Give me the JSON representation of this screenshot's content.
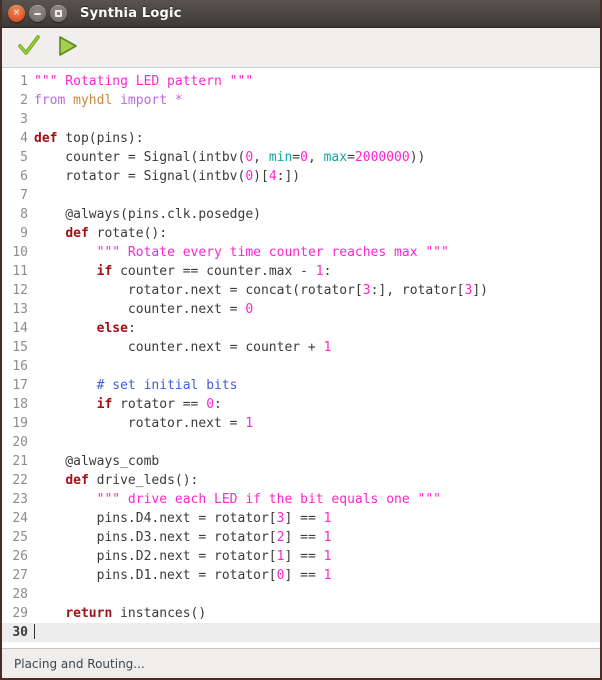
{
  "window": {
    "title": "Synthia Logic",
    "controls": [
      {
        "name": "close",
        "glyph": "×"
      },
      {
        "name": "minimize",
        "glyph": "–"
      },
      {
        "name": "maximize",
        "glyph": "□"
      }
    ]
  },
  "toolbar": {
    "buttons": [
      {
        "name": "check-icon",
        "label": "Check",
        "color": "#7cb518"
      },
      {
        "name": "play-icon",
        "label": "Run",
        "color": "#8cc63f"
      }
    ]
  },
  "statusbar": {
    "message": "Placing and Routing..."
  },
  "editor": {
    "current_line": 30,
    "total_lines": 30,
    "colors": {
      "keyword": "#a11117",
      "string": "#ff25d0",
      "number": "#ff25d0",
      "kwarg": "#10a5a5",
      "comment": "#3f5ed8",
      "import": "#b96ad9",
      "module": "#c48a3f",
      "plain": "#3b3b3b",
      "current_line_bg": "#ededed"
    },
    "lines": [
      {
        "n": 1,
        "tokens": [
          {
            "t": "str",
            "s": "\"\"\" Rotating LED pattern \"\"\""
          }
        ]
      },
      {
        "n": 2,
        "tokens": [
          {
            "t": "imp",
            "s": "from "
          },
          {
            "t": "mod",
            "s": "myhdl"
          },
          {
            "t": "imp",
            "s": " import "
          },
          {
            "t": "imp",
            "s": "*"
          }
        ]
      },
      {
        "n": 3,
        "tokens": []
      },
      {
        "n": 4,
        "tokens": [
          {
            "t": "kw",
            "s": "def"
          },
          {
            "t": "pl",
            "s": " top(pins):"
          }
        ]
      },
      {
        "n": 5,
        "tokens": [
          {
            "t": "pl",
            "s": "    counter = Signal(intbv("
          },
          {
            "t": "num",
            "s": "0"
          },
          {
            "t": "pl",
            "s": ", "
          },
          {
            "t": "kwarg",
            "s": "min"
          },
          {
            "t": "pl",
            "s": "="
          },
          {
            "t": "num",
            "s": "0"
          },
          {
            "t": "pl",
            "s": ", "
          },
          {
            "t": "kwarg",
            "s": "max"
          },
          {
            "t": "pl",
            "s": "="
          },
          {
            "t": "num",
            "s": "2000000"
          },
          {
            "t": "pl",
            "s": "))"
          }
        ]
      },
      {
        "n": 6,
        "tokens": [
          {
            "t": "pl",
            "s": "    rotator = Signal(intbv("
          },
          {
            "t": "num",
            "s": "0"
          },
          {
            "t": "pl",
            "s": ")["
          },
          {
            "t": "num",
            "s": "4"
          },
          {
            "t": "pl",
            "s": ":])"
          }
        ]
      },
      {
        "n": 7,
        "tokens": []
      },
      {
        "n": 8,
        "tokens": [
          {
            "t": "pl",
            "s": "    @always(pins.clk.posedge)"
          }
        ]
      },
      {
        "n": 9,
        "tokens": [
          {
            "t": "pl",
            "s": "    "
          },
          {
            "t": "kw",
            "s": "def"
          },
          {
            "t": "pl",
            "s": " rotate():"
          }
        ]
      },
      {
        "n": 10,
        "tokens": [
          {
            "t": "pl",
            "s": "        "
          },
          {
            "t": "str",
            "s": "\"\"\" Rotate every time counter reaches max \"\"\""
          }
        ]
      },
      {
        "n": 11,
        "tokens": [
          {
            "t": "pl",
            "s": "        "
          },
          {
            "t": "kw",
            "s": "if"
          },
          {
            "t": "pl",
            "s": " counter == counter.max - "
          },
          {
            "t": "num",
            "s": "1"
          },
          {
            "t": "pl",
            "s": ":"
          }
        ]
      },
      {
        "n": 12,
        "tokens": [
          {
            "t": "pl",
            "s": "            rotator.next = concat(rotator["
          },
          {
            "t": "num",
            "s": "3"
          },
          {
            "t": "pl",
            "s": ":], rotator["
          },
          {
            "t": "num",
            "s": "3"
          },
          {
            "t": "pl",
            "s": "])"
          }
        ]
      },
      {
        "n": 13,
        "tokens": [
          {
            "t": "pl",
            "s": "            counter.next = "
          },
          {
            "t": "num",
            "s": "0"
          }
        ]
      },
      {
        "n": 14,
        "tokens": [
          {
            "t": "pl",
            "s": "        "
          },
          {
            "t": "kw",
            "s": "else"
          },
          {
            "t": "pl",
            "s": ":"
          }
        ]
      },
      {
        "n": 15,
        "tokens": [
          {
            "t": "pl",
            "s": "            counter.next = counter + "
          },
          {
            "t": "num",
            "s": "1"
          }
        ]
      },
      {
        "n": 16,
        "tokens": []
      },
      {
        "n": 17,
        "tokens": [
          {
            "t": "pl",
            "s": "        "
          },
          {
            "t": "com",
            "s": "# set initial bits"
          }
        ]
      },
      {
        "n": 18,
        "tokens": [
          {
            "t": "pl",
            "s": "        "
          },
          {
            "t": "kw",
            "s": "if"
          },
          {
            "t": "pl",
            "s": " rotator == "
          },
          {
            "t": "num",
            "s": "0"
          },
          {
            "t": "pl",
            "s": ":"
          }
        ]
      },
      {
        "n": 19,
        "tokens": [
          {
            "t": "pl",
            "s": "            rotator.next = "
          },
          {
            "t": "num",
            "s": "1"
          }
        ]
      },
      {
        "n": 20,
        "tokens": []
      },
      {
        "n": 21,
        "tokens": [
          {
            "t": "pl",
            "s": "    @always_comb"
          }
        ]
      },
      {
        "n": 22,
        "tokens": [
          {
            "t": "pl",
            "s": "    "
          },
          {
            "t": "kw",
            "s": "def"
          },
          {
            "t": "pl",
            "s": " drive_leds():"
          }
        ]
      },
      {
        "n": 23,
        "tokens": [
          {
            "t": "pl",
            "s": "        "
          },
          {
            "t": "str",
            "s": "\"\"\" drive each LED if the bit equals one \"\"\""
          }
        ]
      },
      {
        "n": 24,
        "tokens": [
          {
            "t": "pl",
            "s": "        pins.D4.next = rotator["
          },
          {
            "t": "num",
            "s": "3"
          },
          {
            "t": "pl",
            "s": "] == "
          },
          {
            "t": "num",
            "s": "1"
          }
        ]
      },
      {
        "n": 25,
        "tokens": [
          {
            "t": "pl",
            "s": "        pins.D3.next = rotator["
          },
          {
            "t": "num",
            "s": "2"
          },
          {
            "t": "pl",
            "s": "] == "
          },
          {
            "t": "num",
            "s": "1"
          }
        ]
      },
      {
        "n": 26,
        "tokens": [
          {
            "t": "pl",
            "s": "        pins.D2.next = rotator["
          },
          {
            "t": "num",
            "s": "1"
          },
          {
            "t": "pl",
            "s": "] == "
          },
          {
            "t": "num",
            "s": "1"
          }
        ]
      },
      {
        "n": 27,
        "tokens": [
          {
            "t": "pl",
            "s": "        pins.D1.next = rotator["
          },
          {
            "t": "num",
            "s": "0"
          },
          {
            "t": "pl",
            "s": "] == "
          },
          {
            "t": "num",
            "s": "1"
          }
        ]
      },
      {
        "n": 28,
        "tokens": []
      },
      {
        "n": 29,
        "tokens": [
          {
            "t": "pl",
            "s": "    "
          },
          {
            "t": "kw",
            "s": "return"
          },
          {
            "t": "pl",
            "s": " instances()"
          }
        ]
      },
      {
        "n": 30,
        "tokens": [],
        "current": true,
        "caret": true
      }
    ]
  }
}
